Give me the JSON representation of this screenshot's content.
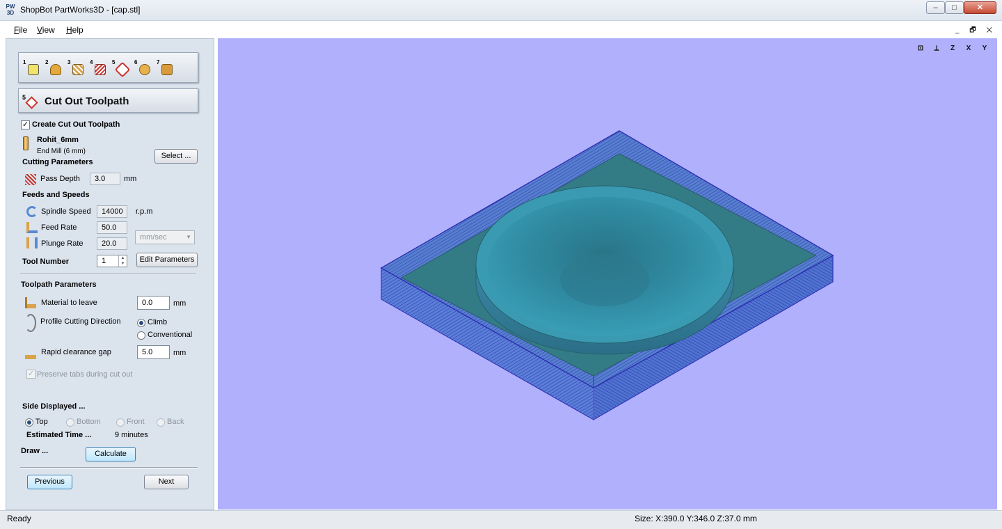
{
  "window": {
    "app_logo": "PW 3D",
    "title": "ShopBot PartWorks3D - [cap.stl]",
    "minimize_glyph": "–",
    "maximize_glyph": "□",
    "close_glyph": "✕"
  },
  "menu": {
    "items": [
      "File",
      "View",
      "Help"
    ],
    "mdi_controls": [
      "_",
      "🗗",
      "✕"
    ]
  },
  "toolbar": {
    "steps": [
      {
        "number": "1",
        "icon": "material-setup-icon"
      },
      {
        "number": "2",
        "icon": "orient-model-icon"
      },
      {
        "number": "3",
        "icon": "roughing-toolpath-icon"
      },
      {
        "number": "4",
        "icon": "finishing-toolpath-icon"
      },
      {
        "number": "5",
        "icon": "cutout-toolpath-icon"
      },
      {
        "number": "6",
        "icon": "preview-toolpath-icon"
      },
      {
        "number": "7",
        "icon": "save-toolpath-icon"
      }
    ]
  },
  "panel": {
    "header_number": "5",
    "header_title": "Cut Out Toolpath",
    "create_checkbox_label": "Create Cut Out Toolpath",
    "create_checked": "✓",
    "tool_name": "Rohit_6mm",
    "tool_type": "End Mill (6 mm)",
    "select_button": "Select ...",
    "cutting_parameters_heading": "Cutting Parameters",
    "pass_depth_label": "Pass Depth",
    "pass_depth_value": "3.0",
    "pass_depth_unit": "mm",
    "feeds_heading": "Feeds and Speeds",
    "spindle_label": "Spindle Speed",
    "spindle_value": "14000",
    "spindle_unit": "r.p.m",
    "feed_label": "Feed Rate",
    "feed_value": "50.0",
    "plunge_label": "Plunge Rate",
    "plunge_value": "20.0",
    "rate_unit": "mm/sec",
    "tool_number_label": "Tool Number",
    "tool_number_value": "1",
    "edit_params_button": "Edit Parameters",
    "toolpath_params_heading": "Toolpath Parameters",
    "material_leave_label": "Material to leave",
    "material_leave_value": "0.0",
    "material_leave_unit": "mm",
    "direction_label": "Profile Cutting Direction",
    "direction_climb": "Climb",
    "direction_conventional": "Conventional",
    "rapid_gap_label": "Rapid clearance gap",
    "rapid_gap_value": "5.0",
    "rapid_gap_unit": "mm",
    "preserve_tabs_label": "Preserve tabs during cut out",
    "preserve_checked": "✓",
    "side_heading": "Side Displayed ...",
    "side_top": "Top",
    "side_bottom": "Bottom",
    "side_front": "Front",
    "side_back": "Back",
    "estimated_label": "Estimated Time ...",
    "estimated_value": "9 minutes",
    "draw_label": "Draw ...",
    "calculate_button": "Calculate",
    "previous_button": "Previous",
    "next_button": "Next"
  },
  "view": {
    "background": "#b0b0fc",
    "icons": [
      "zoom-all-icon",
      "iso-view-icon",
      "top-view-icon",
      "front-view-icon",
      "side-view-icon"
    ],
    "icon_glyphs": [
      "⊡",
      "⟂",
      "Z",
      "X",
      "Y"
    ]
  },
  "status": {
    "left": "Ready",
    "size": "Size: X:390.0 Y:346.0 Z:37.0 mm"
  }
}
